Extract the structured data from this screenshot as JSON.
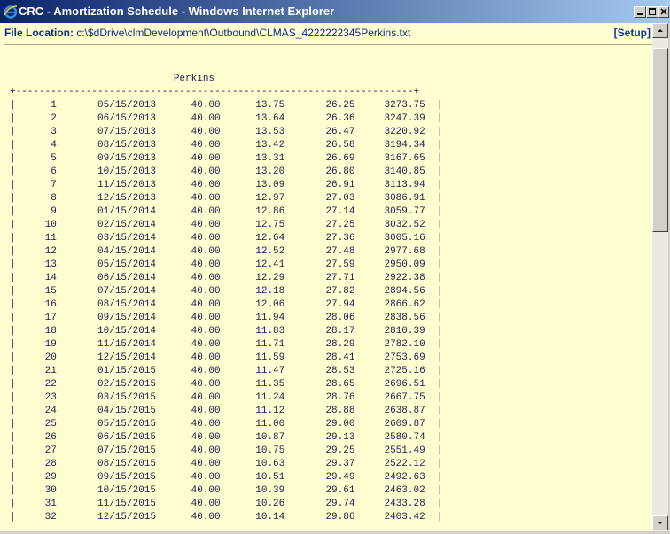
{
  "window": {
    "title": "CRC - Amortization Schedule - Windows Internet Explorer"
  },
  "header": {
    "file_location_label": "File Location:",
    "file_location_value": "c:\\$dDrive\\clmDevelopment\\Outbound\\CLMAS_4222222345Perkins.txt",
    "setup_link": "[Setup]"
  },
  "schedule": {
    "title": "Perkins",
    "rows": [
      [
        "1",
        "05/15/2013",
        "40.00",
        "13.75",
        "26.25",
        "3273.75"
      ],
      [
        "2",
        "06/15/2013",
        "40.00",
        "13.64",
        "26.36",
        "3247.39"
      ],
      [
        "3",
        "07/15/2013",
        "40.00",
        "13.53",
        "26.47",
        "3220.92"
      ],
      [
        "4",
        "08/15/2013",
        "40.00",
        "13.42",
        "26.58",
        "3194.34"
      ],
      [
        "5",
        "09/15/2013",
        "40.00",
        "13.31",
        "26.69",
        "3167.65"
      ],
      [
        "6",
        "10/15/2013",
        "40.00",
        "13.20",
        "26.80",
        "3140.85"
      ],
      [
        "7",
        "11/15/2013",
        "40.00",
        "13.09",
        "26.91",
        "3113.94"
      ],
      [
        "8",
        "12/15/2013",
        "40.00",
        "12.97",
        "27.03",
        "3086.91"
      ],
      [
        "9",
        "01/15/2014",
        "40.00",
        "12.86",
        "27.14",
        "3059.77"
      ],
      [
        "10",
        "02/15/2014",
        "40.00",
        "12.75",
        "27.25",
        "3032.52"
      ],
      [
        "11",
        "03/15/2014",
        "40.00",
        "12.64",
        "27.36",
        "3005.16"
      ],
      [
        "12",
        "04/15/2014",
        "40.00",
        "12.52",
        "27.48",
        "2977.68"
      ],
      [
        "13",
        "05/15/2014",
        "40.00",
        "12.41",
        "27.59",
        "2950.09"
      ],
      [
        "14",
        "06/15/2014",
        "40.00",
        "12.29",
        "27.71",
        "2922.38"
      ],
      [
        "15",
        "07/15/2014",
        "40.00",
        "12.18",
        "27.82",
        "2894.56"
      ],
      [
        "16",
        "08/15/2014",
        "40.00",
        "12.06",
        "27.94",
        "2866.62"
      ],
      [
        "17",
        "09/15/2014",
        "40.00",
        "11.94",
        "28.06",
        "2838.56"
      ],
      [
        "18",
        "10/15/2014",
        "40.00",
        "11.83",
        "28.17",
        "2810.39"
      ],
      [
        "19",
        "11/15/2014",
        "40.00",
        "11.71",
        "28.29",
        "2782.10"
      ],
      [
        "20",
        "12/15/2014",
        "40.00",
        "11.59",
        "28.41",
        "2753.69"
      ],
      [
        "21",
        "01/15/2015",
        "40.00",
        "11.47",
        "28.53",
        "2725.16"
      ],
      [
        "22",
        "02/15/2015",
        "40.00",
        "11.35",
        "28.65",
        "2696.51"
      ],
      [
        "23",
        "03/15/2015",
        "40.00",
        "11.24",
        "28.76",
        "2667.75"
      ],
      [
        "24",
        "04/15/2015",
        "40.00",
        "11.12",
        "28.88",
        "2638.87"
      ],
      [
        "25",
        "05/15/2015",
        "40.00",
        "11.00",
        "29.00",
        "2609.87"
      ],
      [
        "26",
        "06/15/2015",
        "40.00",
        "10.87",
        "29.13",
        "2580.74"
      ],
      [
        "27",
        "07/15/2015",
        "40.00",
        "10.75",
        "29.25",
        "2551.49"
      ],
      [
        "28",
        "08/15/2015",
        "40.00",
        "10.63",
        "29.37",
        "2522.12"
      ],
      [
        "29",
        "09/15/2015",
        "40.00",
        "10.51",
        "29.49",
        "2492.63"
      ],
      [
        "30",
        "10/15/2015",
        "40.00",
        "10.39",
        "29.61",
        "2463.02"
      ],
      [
        "31",
        "11/15/2015",
        "40.00",
        "10.26",
        "29.74",
        "2433.28"
      ],
      [
        "32",
        "12/15/2015",
        "40.00",
        "10.14",
        "29.86",
        "2403.42"
      ]
    ]
  }
}
